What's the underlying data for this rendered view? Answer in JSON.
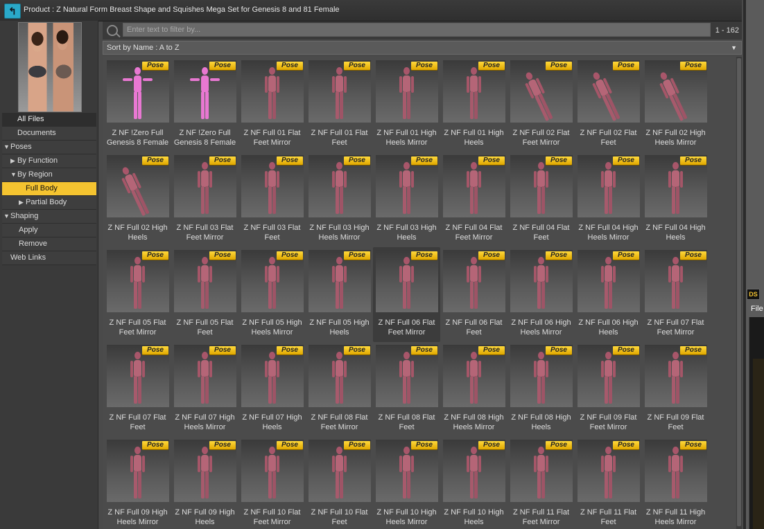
{
  "titlebar": {
    "back_icon": "back-arrow-icon",
    "text": "Product :  Z Natural Form Breast Shape and Squishes Mega Set for Genesis 8 and 81 Female"
  },
  "sidebar": {
    "tree": [
      {
        "label": "All Files",
        "triangle": ""
      },
      {
        "label": "Documents",
        "triangle": ""
      },
      {
        "label": "Poses",
        "triangle": "▼"
      },
      {
        "label": "By Function",
        "triangle": "▶"
      },
      {
        "label": "By Region",
        "triangle": "▼"
      },
      {
        "label": "Full Body",
        "triangle": ""
      },
      {
        "label": "Partial Body",
        "triangle": "▶"
      },
      {
        "label": "Shaping",
        "triangle": "▼"
      },
      {
        "label": "Apply",
        "triangle": ""
      },
      {
        "label": "Remove",
        "triangle": ""
      },
      {
        "label": "Web Links",
        "triangle": ""
      }
    ]
  },
  "filter": {
    "placeholder": "Enter text to filter by...",
    "range": "1 - 162"
  },
  "sort": {
    "label": "Sort by Name : A to Z"
  },
  "badge_text": "Pose",
  "items": [
    {
      "l1": "Z NF !Zero Full",
      "l2": "Genesis 8 Female"
    },
    {
      "l1": "Z NF !Zero Full",
      "l2": "Genesis 8 Female"
    },
    {
      "l1": "Z NF Full 01 Flat",
      "l2": "Feet Mirror"
    },
    {
      "l1": "Z NF Full 01 Flat",
      "l2": "Feet"
    },
    {
      "l1": "Z NF Full 01 High",
      "l2": "Heels Mirror"
    },
    {
      "l1": "Z NF Full 01 High",
      "l2": "Heels"
    },
    {
      "l1": "Z NF Full 02 Flat",
      "l2": "Feet Mirror"
    },
    {
      "l1": "Z NF Full 02 Flat",
      "l2": "Feet"
    },
    {
      "l1": "Z NF Full 02 High",
      "l2": "Heels Mirror"
    },
    {
      "l1": "Z NF Full 02 High",
      "l2": "Heels"
    },
    {
      "l1": "Z NF Full 03 Flat",
      "l2": "Feet Mirror"
    },
    {
      "l1": "Z NF Full 03 Flat",
      "l2": "Feet"
    },
    {
      "l1": "Z NF Full 03 High",
      "l2": "Heels Mirror"
    },
    {
      "l1": "Z NF Full 03 High",
      "l2": "Heels"
    },
    {
      "l1": "Z NF Full 04 Flat",
      "l2": "Feet Mirror"
    },
    {
      "l1": "Z NF Full 04 Flat",
      "l2": "Feet"
    },
    {
      "l1": "Z NF Full 04 High",
      "l2": "Heels Mirror"
    },
    {
      "l1": "Z NF Full 04 High",
      "l2": "Heels"
    },
    {
      "l1": "Z NF Full 05 Flat",
      "l2": "Feet Mirror"
    },
    {
      "l1": "Z NF Full 05 Flat",
      "l2": "Feet"
    },
    {
      "l1": "Z NF Full 05 High",
      "l2": "Heels Mirror"
    },
    {
      "l1": "Z NF Full 05 High",
      "l2": "Heels"
    },
    {
      "l1": "Z NF Full 06 Flat",
      "l2": "Feet Mirror"
    },
    {
      "l1": "Z NF Full 06 Flat",
      "l2": "Feet"
    },
    {
      "l1": "Z NF Full 06 High",
      "l2": "Heels Mirror"
    },
    {
      "l1": "Z NF Full 06 High",
      "l2": "Heels"
    },
    {
      "l1": "Z NF Full 07 Flat",
      "l2": "Feet Mirror"
    },
    {
      "l1": "Z NF Full 07 Flat",
      "l2": "Feet"
    },
    {
      "l1": "Z NF Full 07 High",
      "l2": "Heels Mirror"
    },
    {
      "l1": "Z NF Full 07 High",
      "l2": "Heels"
    },
    {
      "l1": "Z NF Full 08 Flat",
      "l2": "Feet Mirror"
    },
    {
      "l1": "Z NF Full 08 Flat",
      "l2": "Feet"
    },
    {
      "l1": "Z NF Full 08 High",
      "l2": "Heels Mirror"
    },
    {
      "l1": "Z NF Full 08 High",
      "l2": "Heels"
    },
    {
      "l1": "Z NF Full 09 Flat",
      "l2": "Feet Mirror"
    },
    {
      "l1": "Z NF Full 09 Flat",
      "l2": "Feet"
    },
    {
      "l1": "Z NF Full 09 High",
      "l2": "Heels Mirror"
    },
    {
      "l1": "Z NF Full 09 High",
      "l2": "Heels"
    },
    {
      "l1": "Z NF Full 10 Flat",
      "l2": "Feet Mirror"
    },
    {
      "l1": "Z NF Full 10 Flat",
      "l2": "Feet"
    },
    {
      "l1": "Z NF Full 10 High",
      "l2": "Heels Mirror"
    },
    {
      "l1": "Z NF Full 10 High",
      "l2": "Heels"
    },
    {
      "l1": "Z NF Full 11 Flat",
      "l2": "Feet Mirror"
    },
    {
      "l1": "Z NF Full 11 Flat",
      "l2": "Feet"
    },
    {
      "l1": "Z NF Full 11 High",
      "l2": "Heels Mirror"
    }
  ],
  "right_panel": {
    "app_badge": "DS",
    "file_menu": "File"
  },
  "colors": {
    "accent_selected": "#f5c430",
    "badge_yellow": "#ffd93b",
    "back_button": "#2aa9c9"
  }
}
